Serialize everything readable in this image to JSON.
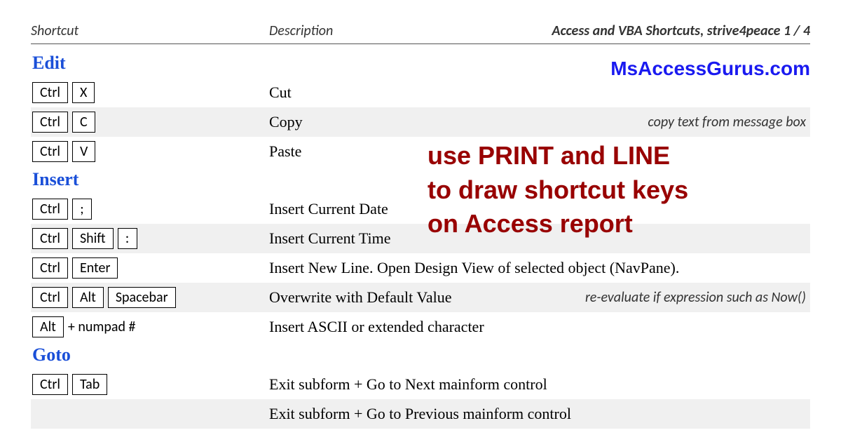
{
  "header": {
    "shortcut": "Shortcut",
    "description": "Description",
    "right": "Access and VBA Shortcuts, strive4peace 1 / 4"
  },
  "site": "MsAccessGurus.com",
  "overlay": {
    "l1": "use PRINT and LINE",
    "l2": "to draw shortcut keys",
    "l3": "on Access report"
  },
  "sections": {
    "edit": {
      "title": "Edit"
    },
    "insert": {
      "title": "Insert"
    },
    "goto": {
      "title": "Goto"
    }
  },
  "rows": {
    "cut": {
      "k1": "Ctrl",
      "k2": "X",
      "desc": "Cut"
    },
    "copy": {
      "k1": "Ctrl",
      "k2": "C",
      "desc": "Copy",
      "note": "copy text from message box"
    },
    "paste": {
      "k1": "Ctrl",
      "k2": "V",
      "desc": "Paste"
    },
    "date": {
      "k1": "Ctrl",
      "k2": ";",
      "desc": "Insert Current Date"
    },
    "time": {
      "k1": "Ctrl",
      "k2": "Shift",
      "k3": ":",
      "desc": "Insert Current Time"
    },
    "newline": {
      "k1": "Ctrl",
      "k2": "Enter",
      "desc": "Insert New Line. Open Design View of selected object (NavPane)."
    },
    "default": {
      "k1": "Ctrl",
      "k2": "Alt",
      "k3": "Spacebar",
      "desc": "Overwrite with Default Value",
      "note": "re-evaluate if expression such as Now()"
    },
    "ascii": {
      "k1": "Alt",
      "extra": "+ numpad #",
      "desc": "Insert ASCII or extended character"
    },
    "tab": {
      "k1": "Ctrl",
      "k2": "Tab",
      "desc": "Exit subform + Go to Next mainform control"
    },
    "prev": {
      "desc": "Exit subform + Go to Previous mainform control"
    }
  }
}
